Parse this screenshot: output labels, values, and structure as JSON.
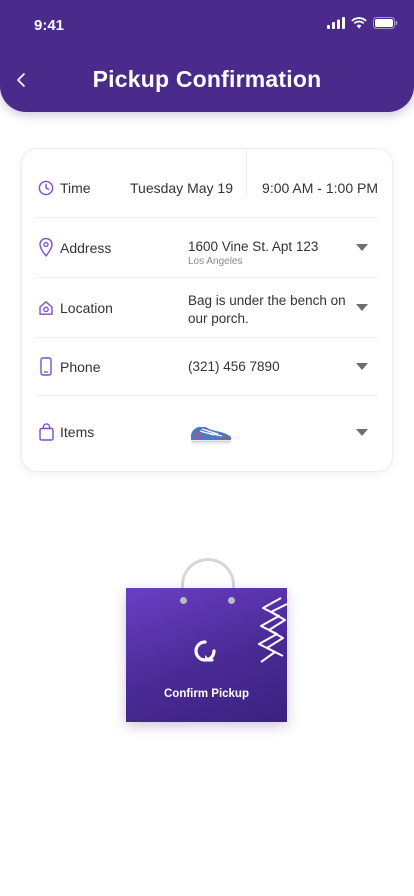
{
  "status_bar": {
    "time": "9:41"
  },
  "header": {
    "title": "Pickup Confirmation"
  },
  "colors": {
    "brand": "#4a2a8a",
    "accent_icon": "#7b4fd0"
  },
  "details": {
    "time": {
      "label": "Time",
      "date": "Tuesday May 19",
      "range": "9:00 AM - 1:00 PM"
    },
    "address": {
      "label": "Address",
      "line1": "1600 Vine St. Apt 123",
      "line2": "Los Angeles"
    },
    "location": {
      "label": "Location",
      "value": "Bag is under the bench on our porch."
    },
    "phone": {
      "label": "Phone",
      "value": "(321) 456 7890"
    },
    "items": {
      "label": "Items",
      "icon": "sneaker-icon"
    }
  },
  "bag": {
    "label": "Confirm Pickup",
    "icon": "refresh-logo-icon"
  }
}
